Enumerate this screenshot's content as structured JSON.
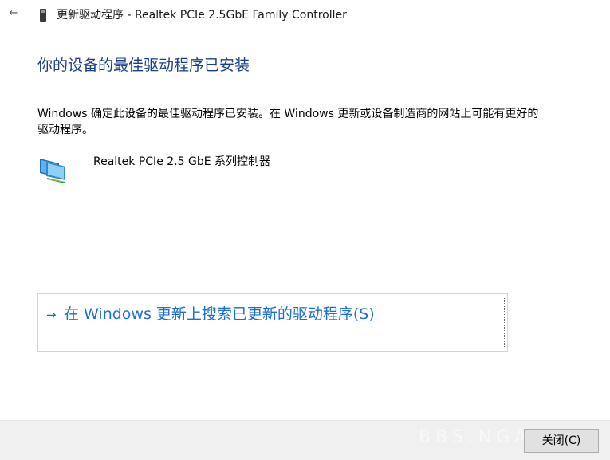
{
  "titlebar": {
    "back_icon": "back-arrow-icon",
    "back_glyph": "←",
    "device_icon": "network-card-icon",
    "title": "更新驱动程序 - Realtek PCIe 2.5GbE Family Controller"
  },
  "main": {
    "heading": "你的设备的最佳驱动程序已安装",
    "description": "Windows 确定此设备的最佳驱动程序已安装。在 Windows 更新或设备制造商的网站上可能有更好的驱动程序。",
    "device": {
      "icon": "network-adapter-icon",
      "name": "Realtek PCIe 2.5 GbE 系列控制器"
    },
    "search_option": {
      "arrow_glyph": "→",
      "label": "在 Windows 更新上搜索已更新的驱动程序(S)"
    }
  },
  "footer": {
    "watermark": "BBS.NGA.CN",
    "close_label": "关闭(C)"
  },
  "colors": {
    "heading": "#1a3d8c",
    "link": "#1a6fd0",
    "footer_bg": "#f0f0f0"
  }
}
